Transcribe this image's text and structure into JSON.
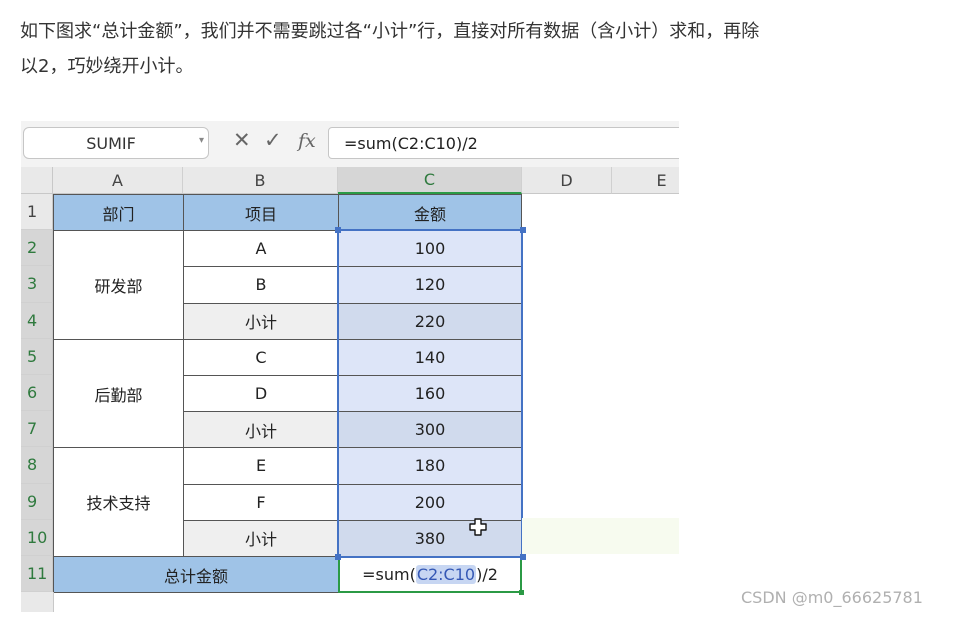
{
  "article": {
    "paragraph_line1": "如下图求“总计金额”，我们并不需要跳过各“小计”行，直接对所有数据（含小计）求和，再除",
    "paragraph_line2": "以2，巧妙绕开小计。"
  },
  "formula_bar": {
    "name_box": "SUMIF",
    "cancel_icon": "✕",
    "enter_icon": "✓",
    "fx_label": "fx",
    "formula": "=sum(C2:C10)/2"
  },
  "sheet": {
    "columns": [
      "A",
      "B",
      "C",
      "D",
      "E"
    ],
    "rows": [
      "1",
      "2",
      "3",
      "4",
      "5",
      "6",
      "7",
      "8",
      "9",
      "10",
      "11"
    ],
    "header": {
      "dept": "部门",
      "item": "项目",
      "amount": "金额"
    },
    "groups": [
      {
        "dept": "研发部",
        "items": [
          "A",
          "B",
          "小计"
        ],
        "amounts": [
          "100",
          "120",
          "220"
        ]
      },
      {
        "dept": "后勤部",
        "items": [
          "C",
          "D",
          "小计"
        ],
        "amounts": [
          "140",
          "160",
          "300"
        ]
      },
      {
        "dept": "技术支持",
        "items": [
          "E",
          "F",
          "小计"
        ],
        "amounts": [
          "180",
          "200",
          "380"
        ]
      }
    ],
    "total_label": "总计金额",
    "total_formula_prefix": "=sum(",
    "total_formula_range": "C2:C10",
    "total_formula_suffix": ")/2"
  },
  "colors": {
    "header_fill": "#9fc3e7",
    "selection_border": "#4472c4",
    "active_border": "#2b9a45"
  },
  "icons": {
    "cursor": "move-cursor-icon"
  },
  "watermark": "CSDN @m0_66625781"
}
